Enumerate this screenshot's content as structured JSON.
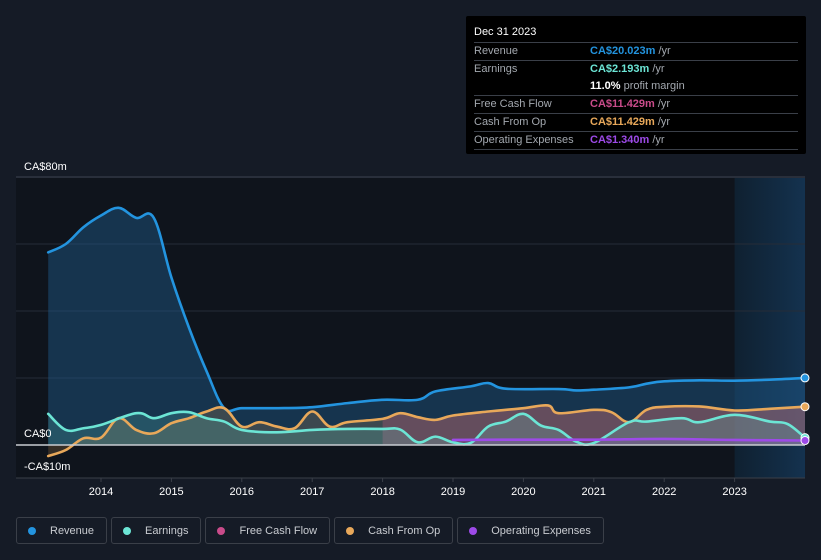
{
  "tooltip": {
    "date": "Dec 31 2023",
    "rows": [
      {
        "label": "Revenue",
        "value": "CA$20.023m",
        "unit": "/yr",
        "color": "#2394df"
      },
      {
        "label": "Earnings",
        "value": "CA$2.193m",
        "unit": "/yr",
        "color": "#6ce5d5"
      },
      {
        "label": "",
        "value": "11.0%",
        "unit": "profit margin",
        "color": "#ffffff"
      },
      {
        "label": "Free Cash Flow",
        "value": "CA$11.429m",
        "unit": "/yr",
        "color": "#c94b8a"
      },
      {
        "label": "Cash From Op",
        "value": "CA$11.429m",
        "unit": "/yr",
        "color": "#e8a85a"
      },
      {
        "label": "Operating Expenses",
        "value": "CA$1.340m",
        "unit": "/yr",
        "color": "#9d4ae8"
      }
    ]
  },
  "legend": [
    {
      "label": "Revenue",
      "color": "#2394df"
    },
    {
      "label": "Earnings",
      "color": "#6ce5d5"
    },
    {
      "label": "Free Cash Flow",
      "color": "#c94b8a"
    },
    {
      "label": "Cash From Op",
      "color": "#e8a85a"
    },
    {
      "label": "Operating Expenses",
      "color": "#9d4ae8"
    }
  ],
  "chart_data": {
    "type": "area",
    "title": "",
    "xlabel": "",
    "ylabel": "",
    "currency": "CA$",
    "y_tick_labels": [
      "CA$80m",
      "CA$0",
      "-CA$10m"
    ],
    "ylim": [
      -10,
      80
    ],
    "y_gridlines": [
      0,
      20,
      40,
      60,
      80
    ],
    "x_ticks": [
      "2014",
      "2015",
      "2016",
      "2017",
      "2018",
      "2019",
      "2020",
      "2021",
      "2022",
      "2023"
    ],
    "xlim": [
      2012.5,
      2024.0
    ],
    "highlight_range": [
      2023.0,
      2024.0
    ],
    "grid": true,
    "legend_position": "bottom",
    "series": [
      {
        "name": "Revenue",
        "color": "#2394df",
        "points": [
          [
            2013.25,
            57.5
          ],
          [
            2013.5,
            60
          ],
          [
            2013.75,
            65
          ],
          [
            2014.0,
            68.5
          ],
          [
            2014.25,
            70.8
          ],
          [
            2014.5,
            67.8
          ],
          [
            2014.75,
            67.8
          ],
          [
            2015.0,
            50
          ],
          [
            2015.25,
            35
          ],
          [
            2015.5,
            22
          ],
          [
            2015.75,
            11
          ],
          [
            2016.0,
            11
          ],
          [
            2016.5,
            11
          ],
          [
            2017.0,
            11.3
          ],
          [
            2017.5,
            12.5
          ],
          [
            2018.0,
            13.5
          ],
          [
            2018.5,
            13.5
          ],
          [
            2018.75,
            16
          ],
          [
            2019.25,
            17.5
          ],
          [
            2019.5,
            18.5
          ],
          [
            2019.75,
            16.8
          ],
          [
            2020.5,
            16.7
          ],
          [
            2020.75,
            16.3
          ],
          [
            2021.0,
            16.5
          ],
          [
            2021.5,
            17.2
          ],
          [
            2021.75,
            18.3
          ],
          [
            2022.0,
            19
          ],
          [
            2022.5,
            19.3
          ],
          [
            2023.0,
            19.2
          ],
          [
            2023.5,
            19.5
          ],
          [
            2024.0,
            20.023
          ]
        ]
      },
      {
        "name": "Earnings",
        "color": "#6ce5d5",
        "points": [
          [
            2013.25,
            9.3
          ],
          [
            2013.5,
            4.5
          ],
          [
            2013.75,
            5
          ],
          [
            2014.0,
            6
          ],
          [
            2014.5,
            9.5
          ],
          [
            2014.75,
            8
          ],
          [
            2015.0,
            9.5
          ],
          [
            2015.25,
            9.8
          ],
          [
            2015.5,
            8
          ],
          [
            2015.75,
            7
          ],
          [
            2016.0,
            4.5
          ],
          [
            2016.5,
            3.8
          ],
          [
            2017.0,
            4.5
          ],
          [
            2017.5,
            4.8
          ],
          [
            2018.0,
            4.8
          ],
          [
            2018.25,
            4.6
          ],
          [
            2018.5,
            0.8
          ],
          [
            2018.75,
            2.5
          ],
          [
            2019.0,
            0.8
          ],
          [
            2019.25,
            0.6
          ],
          [
            2019.5,
            5.5
          ],
          [
            2019.75,
            7
          ],
          [
            2020.0,
            9.3
          ],
          [
            2020.25,
            5.8
          ],
          [
            2020.5,
            4.5
          ],
          [
            2020.75,
            1
          ],
          [
            2021.0,
            0.6
          ],
          [
            2021.5,
            6.8
          ],
          [
            2021.75,
            7
          ],
          [
            2022.25,
            8
          ],
          [
            2022.5,
            6.8
          ],
          [
            2023.0,
            9
          ],
          [
            2023.5,
            7
          ],
          [
            2023.75,
            6.3
          ],
          [
            2024.0,
            2.193
          ]
        ]
      },
      {
        "name": "Free Cash Flow",
        "color": "#c94b8a",
        "points": [
          [
            2018.0,
            7.8
          ],
          [
            2018.25,
            9.5
          ],
          [
            2018.5,
            8.3
          ],
          [
            2018.75,
            7.5
          ],
          [
            2019.0,
            8.8
          ],
          [
            2019.5,
            10
          ],
          [
            2020.0,
            11
          ],
          [
            2020.35,
            11.8
          ],
          [
            2020.5,
            9.5
          ],
          [
            2021.0,
            10.5
          ],
          [
            2021.25,
            9.8
          ],
          [
            2021.5,
            6.8
          ],
          [
            2021.75,
            10.5
          ],
          [
            2022.0,
            11.4
          ],
          [
            2022.5,
            11.5
          ],
          [
            2023.0,
            10.3
          ],
          [
            2023.5,
            10.8
          ],
          [
            2024.0,
            11.429
          ]
        ]
      },
      {
        "name": "Cash From Op",
        "color": "#e8a85a",
        "points": [
          [
            2013.25,
            -3.3
          ],
          [
            2013.5,
            -1.5
          ],
          [
            2013.75,
            2
          ],
          [
            2014.0,
            2.2
          ],
          [
            2014.25,
            8
          ],
          [
            2014.5,
            4.5
          ],
          [
            2014.75,
            3.5
          ],
          [
            2015.0,
            6.5
          ],
          [
            2015.25,
            8
          ],
          [
            2015.5,
            10
          ],
          [
            2015.75,
            11
          ],
          [
            2016.0,
            5.5
          ],
          [
            2016.25,
            6.8
          ],
          [
            2016.5,
            5.5
          ],
          [
            2016.75,
            5
          ],
          [
            2017.0,
            10
          ],
          [
            2017.25,
            5.5
          ],
          [
            2017.5,
            6.8
          ],
          [
            2018.0,
            7.8
          ],
          [
            2018.25,
            9.5
          ],
          [
            2018.5,
            8.3
          ],
          [
            2018.75,
            7.5
          ],
          [
            2019.0,
            8.8
          ],
          [
            2019.5,
            10
          ],
          [
            2020.0,
            11
          ],
          [
            2020.35,
            11.8
          ],
          [
            2020.5,
            9.5
          ],
          [
            2021.0,
            10.5
          ],
          [
            2021.25,
            9.8
          ],
          [
            2021.5,
            6.8
          ],
          [
            2021.75,
            10.5
          ],
          [
            2022.0,
            11.4
          ],
          [
            2022.5,
            11.5
          ],
          [
            2023.0,
            10.3
          ],
          [
            2023.5,
            10.8
          ],
          [
            2024.0,
            11.429
          ]
        ]
      },
      {
        "name": "Operating Expenses",
        "color": "#9d4ae8",
        "points": [
          [
            2019.0,
            1.5
          ],
          [
            2020.0,
            1.6
          ],
          [
            2021.0,
            1.6
          ],
          [
            2022.0,
            1.8
          ],
          [
            2023.0,
            1.5
          ],
          [
            2024.0,
            1.34
          ]
        ]
      }
    ]
  }
}
